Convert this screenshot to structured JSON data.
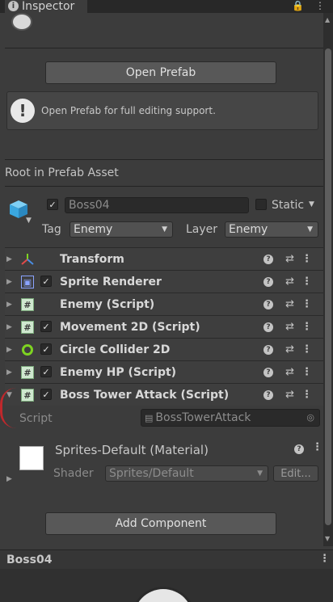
{
  "tab": {
    "label": "Inspector"
  },
  "prefab": {
    "open_button": "Open Prefab",
    "help_message": "Open Prefab for full editing support.",
    "section_title": "Root in Prefab Asset"
  },
  "object": {
    "name": "Boss04",
    "static_label": "Static",
    "tag_label": "Tag",
    "tag_value": "Enemy",
    "layer_label": "Layer",
    "layer_value": "Enemy"
  },
  "components": [
    {
      "name": "Transform",
      "has_checkbox": false,
      "icon": "transform-icon"
    },
    {
      "name": "Sprite Renderer",
      "has_checkbox": true,
      "icon": "sprite-renderer-icon"
    },
    {
      "name": "Enemy (Script)",
      "has_checkbox": false,
      "icon": "script-icon"
    },
    {
      "name": "Movement 2D (Script)",
      "has_checkbox": true,
      "icon": "script-icon"
    },
    {
      "name": "Circle Collider 2D",
      "has_checkbox": true,
      "icon": "circle-collider-icon"
    },
    {
      "name": "Enemy HP (Script)",
      "has_checkbox": true,
      "icon": "script-icon"
    },
    {
      "name": "Boss Tower Attack (Script)",
      "has_checkbox": true,
      "icon": "script-icon"
    }
  ],
  "script_field": {
    "label": "Script",
    "value": "BossTowerAttack"
  },
  "material": {
    "name": "Sprites-Default (Material)",
    "shader_label": "Shader",
    "shader_value": "Sprites/Default",
    "edit_button": "Edit..."
  },
  "add_component_button": "Add Component",
  "preview_title": "Boss04",
  "colors": {
    "accent": "#3a79bb",
    "collider": "#7ed321",
    "panel": "#3c3c3c"
  }
}
